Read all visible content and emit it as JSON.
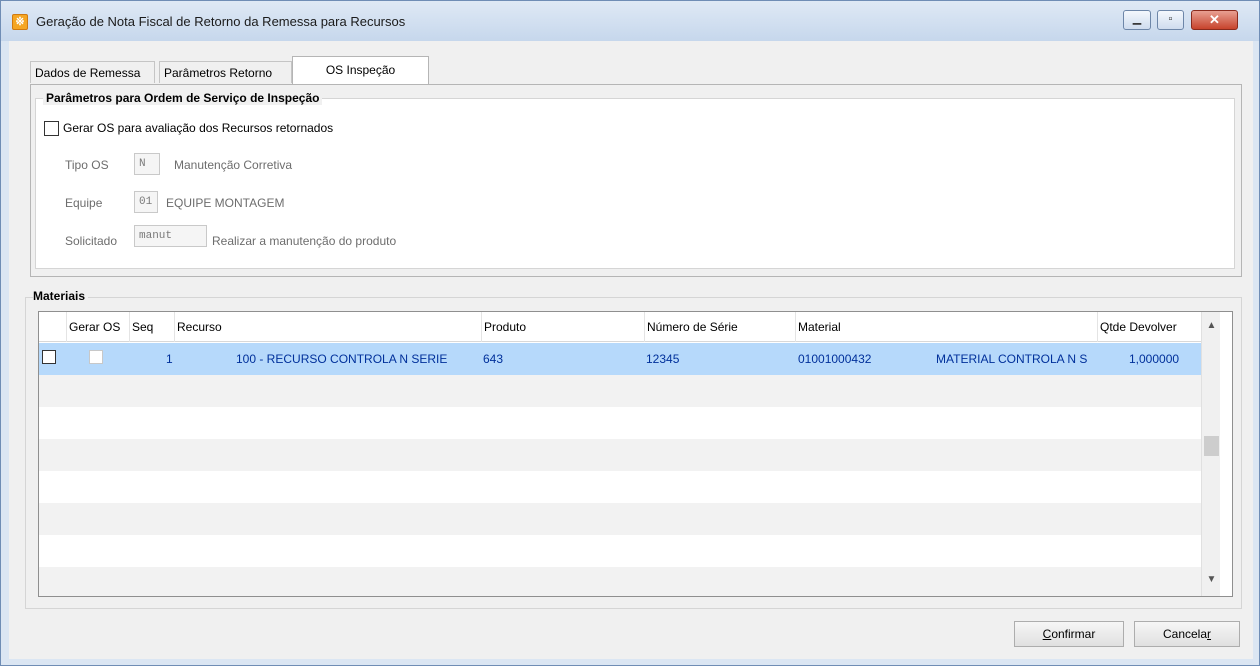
{
  "window": {
    "title": "Geração de Nota Fiscal de Retorno da Remessa para Recursos",
    "min_icon": "minimize-icon",
    "max_icon": "maximize-icon",
    "close_icon": "close-icon"
  },
  "tabs": [
    {
      "label": "Dados de Remessa"
    },
    {
      "label": "Parâmetros Retorno"
    },
    {
      "label": "OS Inspeção"
    }
  ],
  "inspection": {
    "group_title": "Parâmetros para Ordem de Serviço de Inspeção",
    "generate_os_label": "Gerar OS para avaliação dos Recursos retornados",
    "generate_os_checked": false,
    "tipo_os_label": "Tipo OS",
    "tipo_os_value": "N",
    "tipo_os_desc": "Manutenção Corretiva",
    "equipe_label": "Equipe",
    "equipe_value": "01",
    "equipe_desc": "EQUIPE MONTAGEM",
    "solicitado_label": "Solicitado",
    "solicitado_value": "manut",
    "solicitado_desc": "Realizar a manutenção do produto"
  },
  "materials": {
    "group_title": "Materiais",
    "columns": [
      "Gerar OS",
      "Seq",
      "Recurso",
      "Produto",
      "Número de Série",
      "Material",
      "Qtde Devolver"
    ],
    "rows": [
      {
        "selected": false,
        "gerar_os": false,
        "seq": "1",
        "recurso": "100 - RECURSO CONTROLA N SERIE",
        "produto": "643",
        "numero_serie": "12345",
        "material_code": "01001000432",
        "material_desc": "MATERIAL CONTROLA N S",
        "qtde_devolver": "1,000000"
      }
    ]
  },
  "buttons": {
    "confirm_prefix": "",
    "confirm_hot": "C",
    "confirm_rest": "onfirmar",
    "cancel_prefix": "Cancela",
    "cancel_hot": "r",
    "cancel_rest": ""
  },
  "colors": {
    "selected_row": "#b6d9fb",
    "grid_text": "#00309b"
  }
}
